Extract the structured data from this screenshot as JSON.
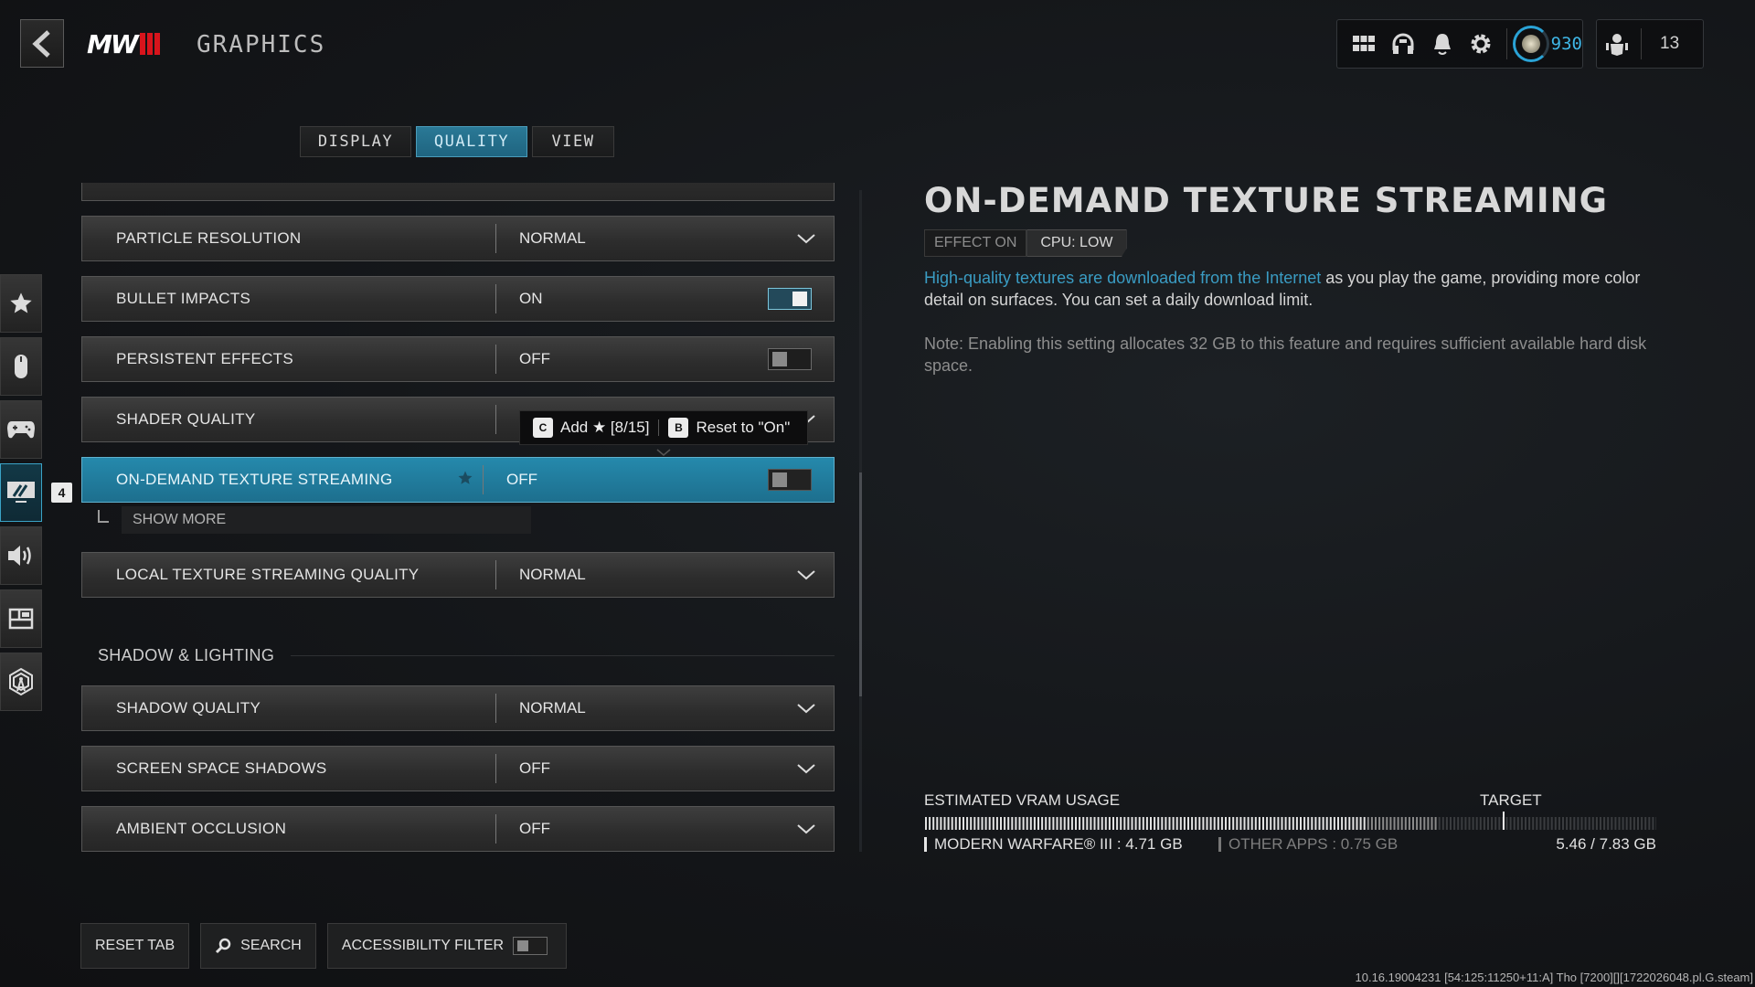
{
  "header": {
    "back_label": "Back",
    "logo_text": "MW",
    "title": "GRAPHICS",
    "icons": [
      "grid-icon",
      "headset-icon",
      "bell-icon",
      "gear-icon"
    ],
    "player_level": "930",
    "party_count": "13"
  },
  "tabs": [
    {
      "label": "DISPLAY",
      "active": false
    },
    {
      "label": "QUALITY",
      "active": true
    },
    {
      "label": "VIEW",
      "active": false
    }
  ],
  "rail": {
    "items": [
      "favorites",
      "mouse-keyboard",
      "controller",
      "graphics",
      "audio",
      "interface",
      "account-network"
    ],
    "active_index": 3,
    "badge": "4"
  },
  "settings": {
    "rows": [
      {
        "name": "PARTICLE RESOLUTION",
        "value": "NORMAL",
        "type": "dropdown"
      },
      {
        "name": "BULLET IMPACTS",
        "value": "ON",
        "type": "toggle",
        "on": true
      },
      {
        "name": "PERSISTENT EFFECTS",
        "value": "OFF",
        "type": "toggle",
        "on": false
      },
      {
        "name": "SHADER QUALITY",
        "value": "",
        "type": "dropdown"
      },
      {
        "name": "ON-DEMAND TEXTURE STREAMING",
        "value": "OFF",
        "type": "toggle",
        "on": false,
        "selected": true,
        "favorite": true
      },
      {
        "name": "LOCAL TEXTURE STREAMING QUALITY",
        "value": "NORMAL",
        "type": "dropdown"
      },
      {
        "name": "SHADOW QUALITY",
        "value": "NORMAL",
        "type": "dropdown"
      },
      {
        "name": "SCREEN SPACE SHADOWS",
        "value": "OFF",
        "type": "dropdown"
      },
      {
        "name": "AMBIENT OCCLUSION",
        "value": "OFF",
        "type": "dropdown"
      }
    ],
    "show_more": "SHOW MORE",
    "section_shadow": "SHADOW & LIGHTING"
  },
  "tooltip": {
    "key1": "C",
    "action1": "Add ★ [8/15]",
    "key2": "B",
    "action2": "Reset to \"On\""
  },
  "detail": {
    "title": "ON-DEMAND TEXTURE STREAMING",
    "tag_effect": "EFFECT ON",
    "tag_cpu": "CPU: LOW",
    "desc_highlight": "High-quality textures are downloaded from the Internet",
    "desc_rest": " as you play the game, providing more color detail on surfaces. You can set a daily download limit.",
    "note": "Note: Enabling this setting allocates 32 GB to this feature and requires sufficient available hard disk space."
  },
  "vram": {
    "label": "ESTIMATED VRAM USAGE",
    "target_label": "TARGET",
    "game_label": "MODERN WARFARE® III : 4.71 GB",
    "other_label": "OTHER APPS : 0.75 GB",
    "total": "5.46 / 7.83 GB",
    "game_gb": 4.71,
    "other_gb": 0.75,
    "total_gb": 7.83,
    "target_fraction": 0.79
  },
  "bottom": {
    "reset_tab": "RESET TAB",
    "search": "SEARCH",
    "accessibility": "ACCESSIBILITY FILTER",
    "accessibility_on": false
  },
  "build_info": "10.16.19004231 [54:125:11250+11:A] Tho [7200][][1722026048.pl.G.steam]",
  "colors": {
    "accent": "#2589ac",
    "level": "#3fb6e6",
    "logo_red": "#d8141c"
  }
}
